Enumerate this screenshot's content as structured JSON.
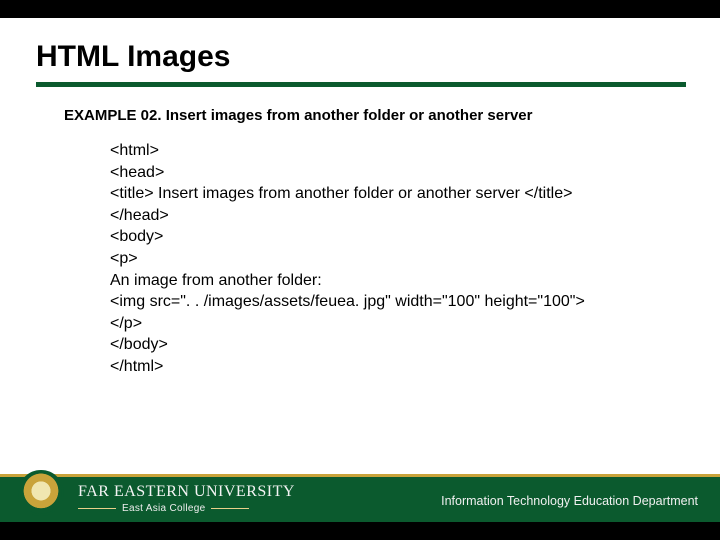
{
  "title": "HTML Images",
  "example_heading": "EXAMPLE 02. Insert images from another folder or another server",
  "code": "<html>\n<head>\n<title> Insert images from another folder or another server </title>\n</head>\n<body>\n<p>\nAn image from another folder:\n<img src=\". . /images/assets/feuea. jpg\" width=\"100\" height=\"100\">\n</p>\n</body>\n</html>",
  "footer": {
    "university": "FAR EASTERN UNIVERSITY",
    "college": "East Asia College",
    "department": "Information Technology Education Department"
  }
}
